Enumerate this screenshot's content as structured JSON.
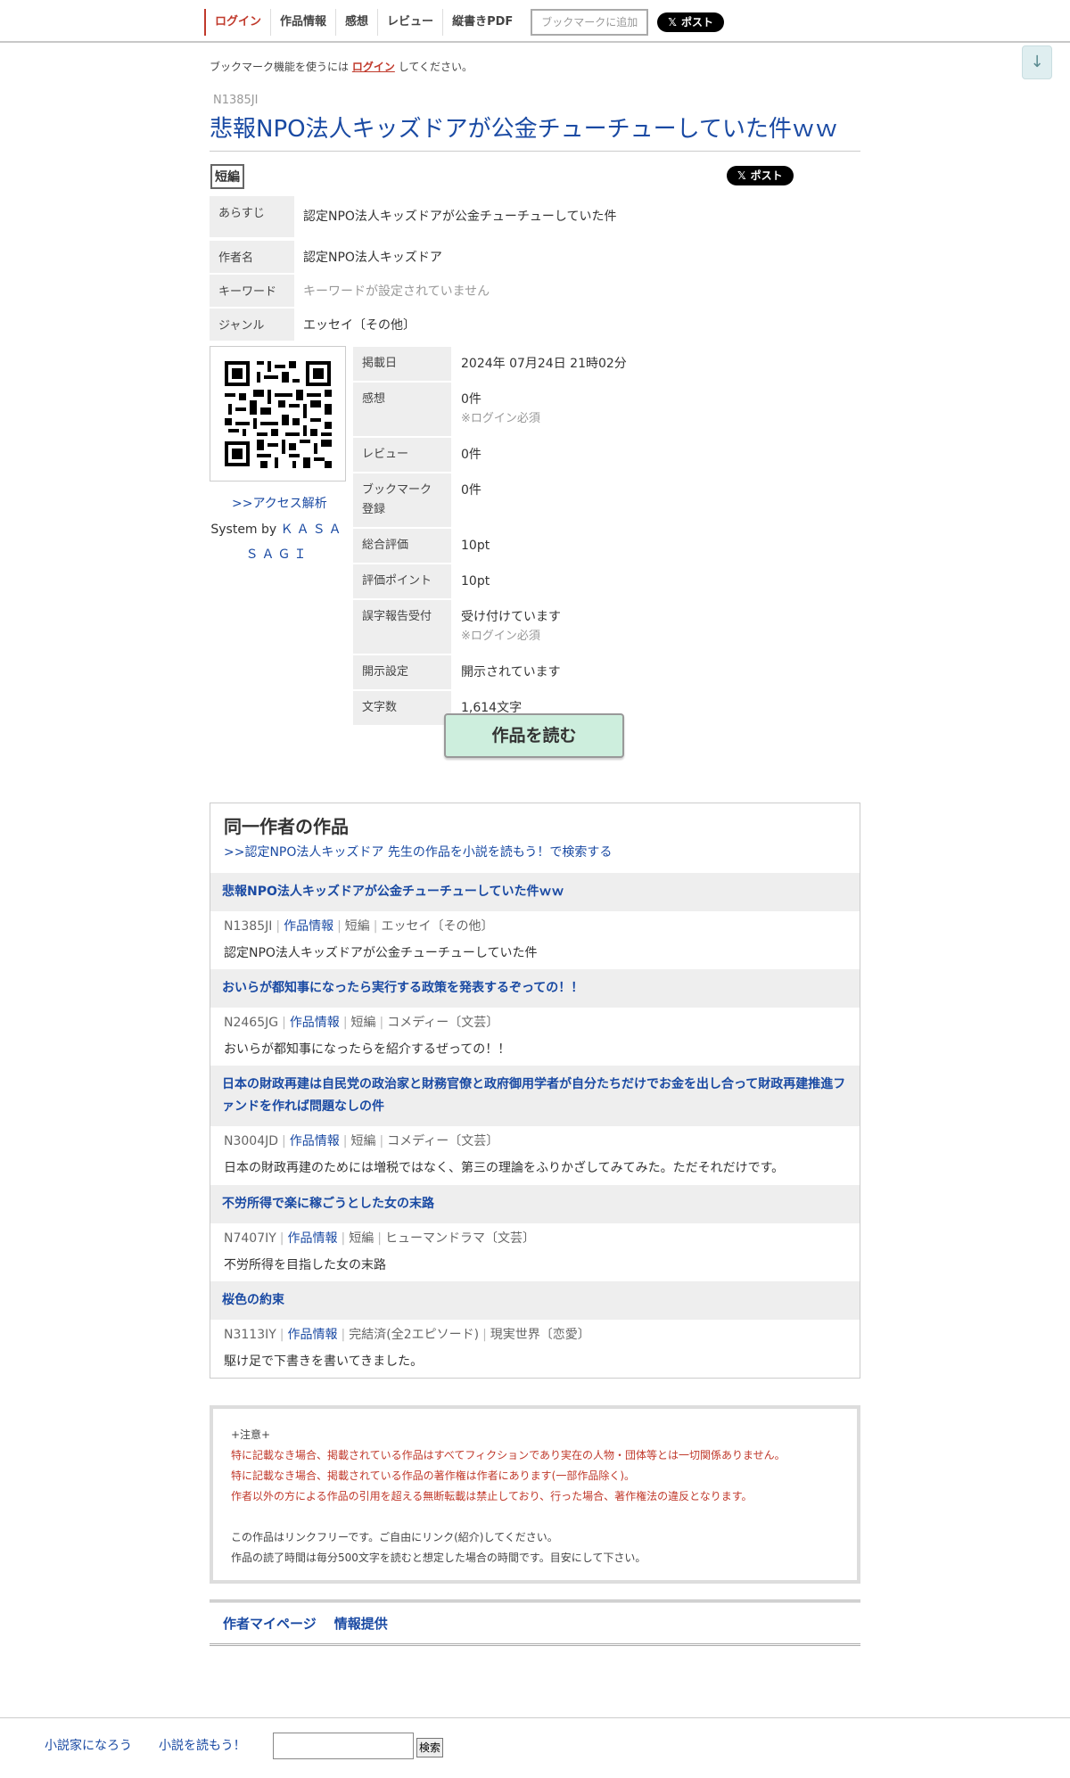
{
  "topnav": {
    "login": "ログイン",
    "info": "作品情報",
    "impressions": "感想",
    "review": "レビュー",
    "pdf": "縦書きPDF",
    "bookmark": "ブックマークに追加",
    "post": "ポスト"
  },
  "scroll_down": "↓",
  "bookmark_notice": {
    "prefix": "ブックマーク機能を使うには",
    "link": "ログイン",
    "suffix": "してください。"
  },
  "ncode": "N1385JI",
  "title": "悲報NPO法人キッズドアが公金チューチューしていた件ｗｗ",
  "type_badge": "短編",
  "post2": "ポスト",
  "info": [
    {
      "k": "あらすじ",
      "v": "認定NPO法人キッズドアが公金チューチューしていた件"
    },
    {
      "k": "作者名",
      "v": "認定NPO法人キッズドア"
    },
    {
      "k": "キーワード",
      "v": "キーワードが設定されていません"
    },
    {
      "k": "ジャンル",
      "v": "エッセイ〔その他〕"
    }
  ],
  "access": ">>アクセス解析",
  "system_by": "System by",
  "kasasagi": "ＫＡＳＡＳＡＧＩ",
  "stats": {
    "published_k": "掲載日",
    "published_v": "2024年 07月24日 21時02分",
    "impressions_k": "感想",
    "impressions_v": "0件",
    "impressions_sub": "※ログイン必須",
    "review_k": "レビュー",
    "review_v": "0件",
    "bookmark_k": "ブックマーク登録",
    "bookmark_v": "0件",
    "total_k": "総合評価",
    "total_v": "10pt",
    "points_k": "評価ポイント",
    "points_v": "10pt",
    "typo_k": "誤字報告受付",
    "typo_v": "受け付けています",
    "typo_sub": "※ログイン必須",
    "disclose_k": "開示設定",
    "disclose_v": "開示されています",
    "chars_k": "文字数",
    "chars_v": "1,614文字"
  },
  "read_button": "作品を読む",
  "same_author": {
    "heading": "同一作者の作品",
    "search_link": ">>認定NPO法人キッズドア 先生の作品を小説を読もう！で検索する",
    "info_label": "作品情報",
    "works": [
      {
        "title": "悲報NPO法人キッズドアが公金チューチューしていた件ｗｗ",
        "ncode": "N1385JI",
        "kind": "短編",
        "genre": "エッセイ〔その他〕",
        "desc": "認定NPO法人キッズドアが公金チューチューしていた件"
      },
      {
        "title": "おいらが都知事になったら実行する政策を発表するぞっての！！",
        "ncode": "N2465JG",
        "kind": "短編",
        "genre": "コメディー〔文芸〕",
        "desc": "おいらが都知事になったらを紹介するぜっての！！"
      },
      {
        "title": "日本の財政再建は自民党の政治家と財務官僚と政府御用学者が自分たちだけでお金を出し合って財政再建推進ファンドを作れば問題なしの件",
        "ncode": "N3004JD",
        "kind": "短編",
        "genre": "コメディー〔文芸〕",
        "desc": "日本の財政再建のためには増税ではなく、第三の理論をふりかざしてみてみた。ただそれだけです。"
      },
      {
        "title": "不労所得で楽に稼ごうとした女の末路",
        "ncode": "N7407IY",
        "kind": "短編",
        "genre": "ヒューマンドラマ〔文芸〕",
        "desc": "不労所得を目指した女の末路"
      },
      {
        "title": "桜色の約束",
        "ncode": "N3113IY",
        "kind": "完結済(全2エピソード)",
        "genre": "現実世界〔恋愛〕",
        "desc": "駆け足で下書きを書いてきました。"
      }
    ]
  },
  "notice": {
    "head": "+注意+",
    "red1": "特に記載なき場合、掲載されている作品はすべてフィクションであり実在の人物・団体等とは一切関係ありません。",
    "red2": "特に記載なき場合、掲載されている作品の著作権は作者にあります(一部作品除く)。",
    "red3": "作者以外の方による作品の引用を超える無断転載は禁止しており、行った場合、著作権法の違反となります。",
    "p1": "この作品はリンクフリーです。ご自由にリンク(紹介)してください。",
    "p2": "作品の読了時間は毎分500文字を読むと想定した場合の時間です。目安にして下さい。"
  },
  "footer_links": {
    "mypage": "作者マイページ",
    "info": "情報提供"
  },
  "bottombar": {
    "link1": "小説家になろう",
    "link2": "小説を読もう！",
    "search_value": "",
    "search_button": "検索"
  }
}
